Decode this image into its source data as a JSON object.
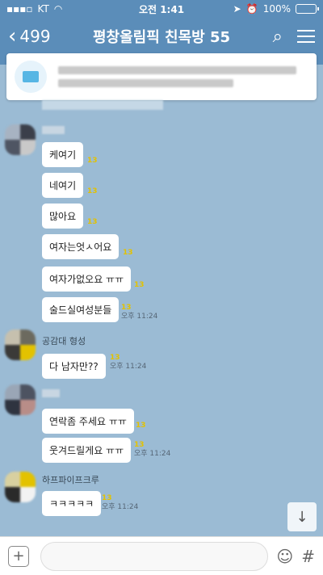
{
  "status_bar": {
    "carrier": "KT",
    "time": "오전 1:41",
    "battery": "100%",
    "battery_level": 1.0
  },
  "header": {
    "back_count": "499",
    "title": "평창올림픽 친목방 55"
  },
  "messages": [
    {
      "sender": "",
      "text": "케여기",
      "count": "13",
      "time": ""
    },
    {
      "sender": "",
      "text": "네여기",
      "count": "13",
      "time": ""
    },
    {
      "sender": "",
      "text": "많아요",
      "count": "13",
      "time": ""
    },
    {
      "sender": "",
      "text": "여자는엇ㅅ어요",
      "count": "13",
      "time": ""
    },
    {
      "sender": "",
      "text": "여자가없오요 ㅠㅠ",
      "count": "13",
      "time": ""
    },
    {
      "sender": "",
      "text": "술드실여성분들",
      "count": "13",
      "time": "오후 11:24"
    },
    {
      "sender": "공감대 형성",
      "text": "다 남자만??",
      "count": "13",
      "time": "오후 11:24"
    },
    {
      "sender": "",
      "text": "연락좀 주세요 ㅠㅠ",
      "count": "13",
      "time": ""
    },
    {
      "sender": "",
      "text": "웃겨드릴게요 ㅠㅠ",
      "count": "13",
      "time": "오후 11:24"
    },
    {
      "sender": "하프파이프크루",
      "text": "ㅋㅋㅋㅋㅋ",
      "count": "13",
      "time": "오후 11:24"
    }
  ],
  "scroll_down_icon": "arrow-down-icon",
  "input": {
    "placeholder": ""
  },
  "colors": {
    "header": "#5b8db9",
    "chat_bg": "#9bbbd4",
    "unread_count": "#e3c200"
  }
}
